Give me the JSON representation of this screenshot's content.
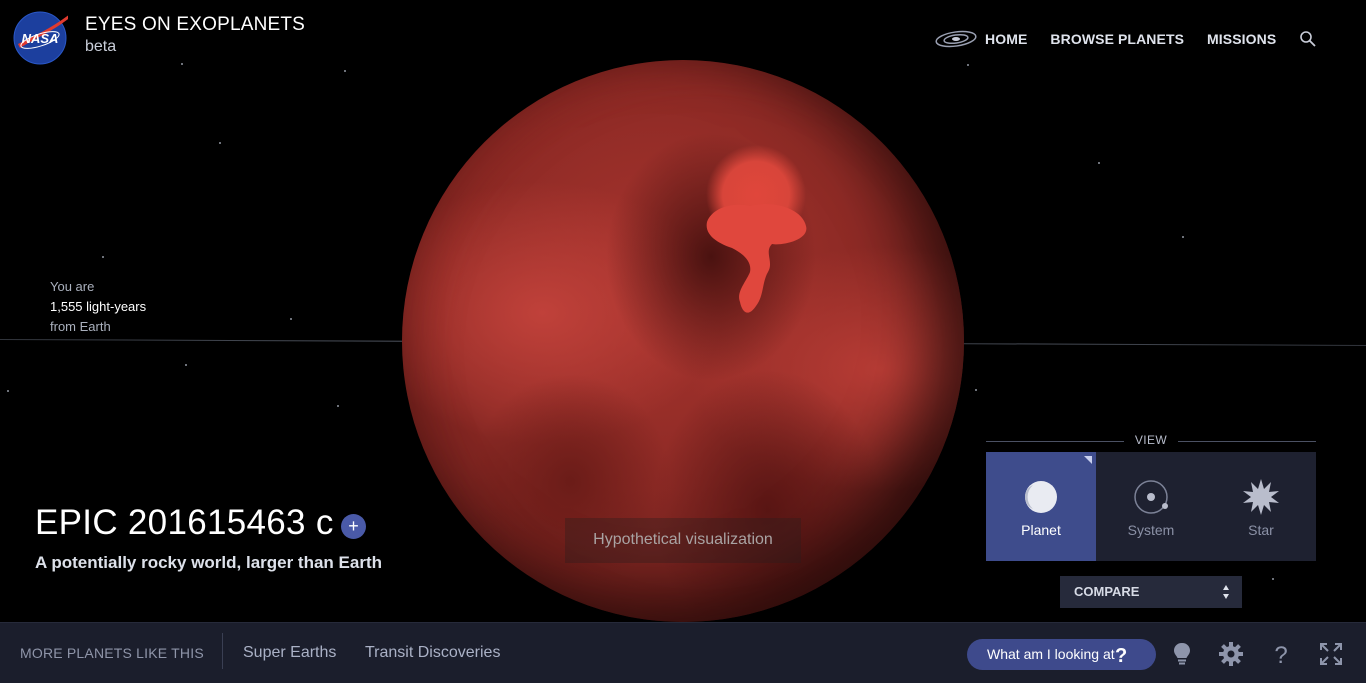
{
  "header": {
    "logo_text": "NASA",
    "title": "EYES ON EXOPLANETS",
    "subtitle": "beta"
  },
  "nav": {
    "home": "HOME",
    "browse": "BROWSE PLANETS",
    "missions": "MISSIONS",
    "search_icon": "search-icon",
    "galaxy_icon": "galaxy-icon"
  },
  "distance": {
    "line1": "You are",
    "value": "1,555 light-years",
    "line3": "from Earth"
  },
  "planet": {
    "name": "EPIC 201615463 c",
    "add_label": "+",
    "tagline": "A potentially rocky world, larger than Earth",
    "visualization_note": "Hypothetical visualization"
  },
  "view_panel": {
    "label": "VIEW",
    "tabs": [
      {
        "label": "Planet",
        "icon": "planet-icon",
        "active": true
      },
      {
        "label": "System",
        "icon": "system-icon",
        "active": false
      },
      {
        "label": "Star",
        "icon": "star-icon",
        "active": false
      }
    ],
    "compare": "COMPARE"
  },
  "bottom_bar": {
    "more_label": "MORE PLANETS LIKE THIS",
    "links": [
      "Super Earths",
      "Transit Discoveries"
    ],
    "what_button": "What am I looking at",
    "what_icon": "?",
    "icons": [
      "lightbulb-icon",
      "gear-icon",
      "help-icon",
      "fullscreen-icon"
    ]
  },
  "colors": {
    "accent": "#3e4c8c",
    "bar_background": "#1b1e2c",
    "planet_red": "#a8342e"
  }
}
